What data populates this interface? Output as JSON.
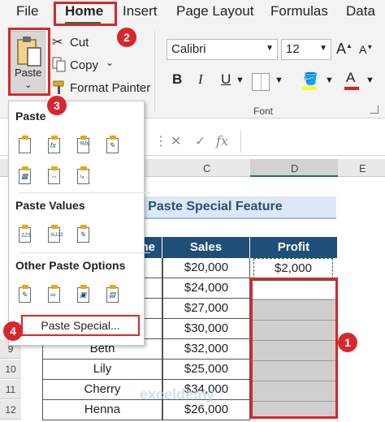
{
  "ribbon": {
    "tabs": [
      "File",
      "Home",
      "Insert",
      "Page Layout",
      "Formulas",
      "Data"
    ],
    "clipboard": {
      "paste_label": "Paste",
      "paste_caret": "⌄",
      "cut_label": "Cut",
      "copy_label": "Copy",
      "copy_caret": "⌄",
      "format_painter_label": "Format Painter"
    },
    "font": {
      "family": "Calibri",
      "size": "12",
      "grow_icon": "A",
      "shrink_icon": "A",
      "bold": "B",
      "italic": "I",
      "underline": "U",
      "font_color_letter": "A",
      "group_label": "Font"
    },
    "accent_color": "#217346"
  },
  "formula_bar": {
    "cancel_symbol": "✕",
    "enter_symbol": "✓",
    "fx_symbol": "fx"
  },
  "grid": {
    "visible_columns": [
      "C",
      "D",
      "E"
    ],
    "row_numbers": [
      "9",
      "10",
      "11",
      "12"
    ],
    "title_fragment": "g Paste Special Feature",
    "headers": {
      "name_fragment": "ne",
      "sales": "Sales",
      "profit": "Profit"
    },
    "rows": [
      {
        "name": "",
        "sales": "$20,000",
        "profit": "$2,000"
      },
      {
        "name": "",
        "sales": "$24,000",
        "profit": ""
      },
      {
        "name": "",
        "sales": "$27,000",
        "profit": ""
      },
      {
        "name": "",
        "sales": "$30,000",
        "profit": ""
      },
      {
        "name": "Beth",
        "sales": "$32,000",
        "profit": ""
      },
      {
        "name": "Lily",
        "sales": "$25,000",
        "profit": ""
      },
      {
        "name": "Cherry",
        "sales": "$34,000",
        "profit": ""
      },
      {
        "name": "Henna",
        "sales": "$26,000",
        "profit": ""
      }
    ],
    "header_color": "#1f4e79",
    "title_color": "#2b4e7e"
  },
  "paste_menu": {
    "section_paste": "Paste",
    "section_paste_values": "Paste Values",
    "section_other": "Other Paste Options",
    "paste_special_label": "Paste Special...",
    "icon_glyphs": {
      "formulas": "fx",
      "formulas_number": "%fx",
      "values": "123",
      "values_number": "%123"
    }
  },
  "annotations": {
    "step1": "1",
    "step2": "2",
    "step3": "3",
    "step4": "4",
    "color": "#d9262d"
  },
  "watermark": "exceldemy"
}
